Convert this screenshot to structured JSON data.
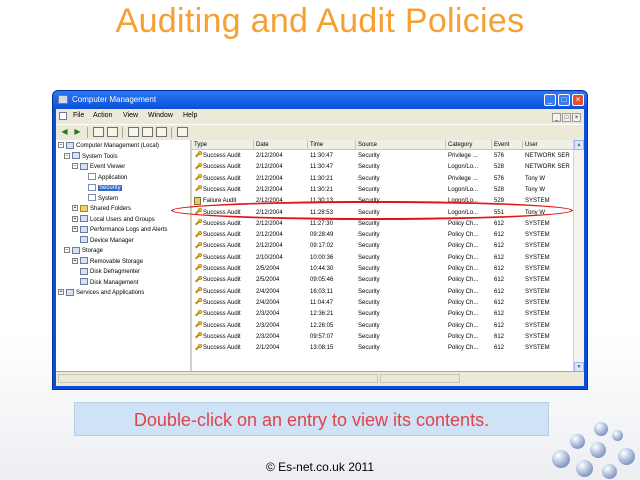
{
  "slide": {
    "title": "Auditing and Audit Policies",
    "instruction": "Double-click on an entry to view its contents.",
    "footer_copyright": "© Es-net.co.uk 2011"
  },
  "window": {
    "title": "Computer Management",
    "menu": [
      "File",
      "Action",
      "View",
      "Window",
      "Help"
    ],
    "title_buttons": [
      "_",
      "□",
      "×"
    ]
  },
  "tree": [
    {
      "label": "Computer Management (Local)",
      "icon": "computer-icon",
      "expanded": true
    },
    {
      "label": "System Tools",
      "icon": "tools-icon",
      "expanded": true
    },
    {
      "label": "Event Viewer",
      "icon": "event-viewer-icon",
      "expanded": true
    },
    {
      "label": "Application",
      "icon": "log-icon"
    },
    {
      "label": "Security",
      "icon": "log-icon",
      "selected": true
    },
    {
      "label": "System",
      "icon": "log-icon"
    },
    {
      "label": "Shared Folders",
      "icon": "folder-icon",
      "expanded": false
    },
    {
      "label": "Local Users and Groups",
      "icon": "users-icon",
      "expanded": false
    },
    {
      "label": "Performance Logs and Alerts",
      "icon": "performance-icon",
      "expanded": false
    },
    {
      "label": "Device Manager",
      "icon": "device-manager-icon"
    },
    {
      "label": "Storage",
      "icon": "storage-icon",
      "expanded": true
    },
    {
      "label": "Removable Storage",
      "icon": "removable-storage-icon",
      "expanded": false
    },
    {
      "label": "Disk Defragmenter",
      "icon": "defrag-icon"
    },
    {
      "label": "Disk Management",
      "icon": "disk-icon"
    },
    {
      "label": "Services and Applications",
      "icon": "services-icon",
      "expanded": false
    }
  ],
  "columns": [
    "Type",
    "Date",
    "Time",
    "Source",
    "Category",
    "Event",
    "User"
  ],
  "events": [
    {
      "type": "Success Audit",
      "date": "2/12/2004",
      "time": "11:30:47",
      "source": "Security",
      "category": "Privilege ...",
      "event": "576",
      "user": "NETWORK SER"
    },
    {
      "type": "Success Audit",
      "date": "2/12/2004",
      "time": "11:30:47",
      "source": "Security",
      "category": "Logon/Lo...",
      "event": "528",
      "user": "NETWORK SER"
    },
    {
      "type": "Success Audit",
      "date": "2/12/2004",
      "time": "11:30:21",
      "source": "Security",
      "category": "Privilege ...",
      "event": "576",
      "user": "Tony W"
    },
    {
      "type": "Success Audit",
      "date": "2/12/2004",
      "time": "11:30:21",
      "source": "Security",
      "category": "Logon/Lo...",
      "event": "528",
      "user": "Tony W"
    },
    {
      "type": "Failure Audit",
      "date": "2/12/2004",
      "time": "11:30:13",
      "source": "Security",
      "category": "Logon/Lo...",
      "event": "529",
      "user": "SYSTEM"
    },
    {
      "type": "Success Audit",
      "date": "2/12/2004",
      "time": "11:28:53",
      "source": "Security",
      "category": "Logon/Lo...",
      "event": "551",
      "user": "Tony W"
    },
    {
      "type": "Success Audit",
      "date": "2/12/2004",
      "time": "11:27:30",
      "source": "Security",
      "category": "Policy Ch...",
      "event": "612",
      "user": "SYSTEM"
    },
    {
      "type": "Success Audit",
      "date": "2/12/2004",
      "time": "09:28:49",
      "source": "Security",
      "category": "Policy Ch...",
      "event": "612",
      "user": "SYSTEM"
    },
    {
      "type": "Success Audit",
      "date": "2/12/2004",
      "time": "09:17:02",
      "source": "Security",
      "category": "Policy Ch...",
      "event": "612",
      "user": "SYSTEM"
    },
    {
      "type": "Success Audit",
      "date": "2/10/2004",
      "time": "10:00:36",
      "source": "Security",
      "category": "Policy Ch...",
      "event": "612",
      "user": "SYSTEM"
    },
    {
      "type": "Success Audit",
      "date": "2/5/2004",
      "time": "10:44:30",
      "source": "Security",
      "category": "Policy Ch...",
      "event": "612",
      "user": "SYSTEM"
    },
    {
      "type": "Success Audit",
      "date": "2/5/2004",
      "time": "09:05:46",
      "source": "Security",
      "category": "Policy Ch...",
      "event": "612",
      "user": "SYSTEM"
    },
    {
      "type": "Success Audit",
      "date": "2/4/2004",
      "time": "16:03:11",
      "source": "Security",
      "category": "Policy Ch...",
      "event": "612",
      "user": "SYSTEM"
    },
    {
      "type": "Success Audit",
      "date": "2/4/2004",
      "time": "11:04:47",
      "source": "Security",
      "category": "Policy Ch...",
      "event": "612",
      "user": "SYSTEM"
    },
    {
      "type": "Success Audit",
      "date": "2/3/2004",
      "time": "12:36:21",
      "source": "Security",
      "category": "Policy Ch...",
      "event": "612",
      "user": "SYSTEM"
    },
    {
      "type": "Success Audit",
      "date": "2/3/2004",
      "time": "12:26:05",
      "source": "Security",
      "category": "Policy Ch...",
      "event": "612",
      "user": "SYSTEM"
    },
    {
      "type": "Success Audit",
      "date": "2/3/2004",
      "time": "09:57:07",
      "source": "Security",
      "category": "Policy Ch...",
      "event": "612",
      "user": "SYSTEM"
    },
    {
      "type": "Success Audit",
      "date": "2/1/2004",
      "time": "13:08:15",
      "source": "Security",
      "category": "Policy Ch...",
      "event": "612",
      "user": "SYSTEM"
    }
  ],
  "colors": {
    "title": "#f5a033",
    "instruction_text": "#e0434a",
    "instruction_bg": "#cfe2f6",
    "xp_titlebar": "#0a50d8",
    "highlight_ellipse": "#e01616",
    "selection": "#316ac5"
  }
}
